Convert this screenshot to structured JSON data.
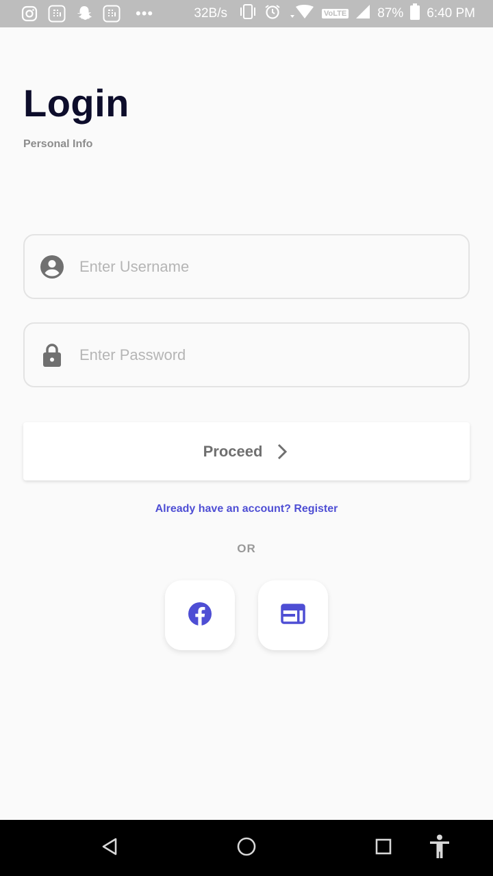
{
  "status_bar": {
    "speed": "32B/s",
    "network_badge": "VoLTE",
    "battery": "87%",
    "time": "6:40 PM",
    "notification_icons": [
      "instagram-icon",
      "calculator-icon",
      "snapchat-icon",
      "calculator-icon"
    ],
    "more": "•••"
  },
  "header": {
    "title": "Login",
    "subtitle": "Personal Info"
  },
  "form": {
    "username_placeholder": "Enter Username",
    "username_value": "",
    "password_placeholder": "Enter Password",
    "password_value": "",
    "proceed_label": "Proceed"
  },
  "register_link": "Already have an account? Register",
  "or_text": "OR",
  "social": {
    "buttons": [
      "facebook-icon",
      "web-icon"
    ]
  },
  "colors": {
    "accent": "#4e4ed4",
    "title": "#0d0d2b",
    "background": "#fafafa"
  }
}
